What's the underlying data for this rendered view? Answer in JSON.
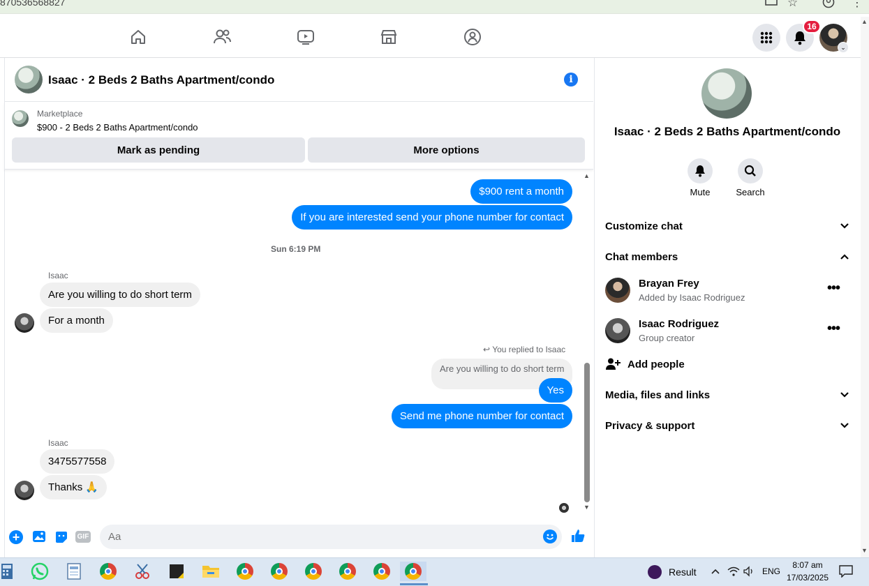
{
  "browser": {
    "url_fragment": "870536568827"
  },
  "nav": {
    "notification_count": "16"
  },
  "chat": {
    "title": "Isaac · 2 Beds 2 Baths Apartment/condo",
    "marketplace_label": "Marketplace",
    "listing": "$900 - 2 Beds 2 Baths Apartment/condo",
    "mark_pending_label": "Mark as pending",
    "more_options_label": "More options"
  },
  "messages": {
    "out1": "$900 rent a month",
    "out2": "If you are interested send your phone number for contact",
    "timestamp": "Sun 6:19 PM",
    "sender1": "Isaac",
    "in1": "Are you willing to do short term",
    "in2": "For a month",
    "replied_label": "You replied to Isaac",
    "quoted": "Are you willing to do short term",
    "out3": "Yes",
    "out4": "Send me phone number for contact",
    "sender2": "Isaac",
    "in3": "3475577558",
    "in4": "Thanks 🙏"
  },
  "composer": {
    "placeholder": "Aa"
  },
  "sidebar": {
    "title": "Isaac · 2 Beds 2 Baths Apartment/condo",
    "mute_label": "Mute",
    "search_label": "Search",
    "customize_label": "Customize chat",
    "members_label": "Chat members",
    "members": [
      {
        "name": "Brayan Frey",
        "sub": "Added by Isaac Rodriguez"
      },
      {
        "name": "Isaac Rodriguez",
        "sub": "Group creator"
      }
    ],
    "add_people_label": "Add people",
    "media_label": "Media, files and links",
    "privacy_label": "Privacy & support"
  },
  "taskbar": {
    "result_label": "Result",
    "lang": "ENG",
    "time": "8:07 am",
    "date": "17/03/2025"
  },
  "colors": {
    "messenger_blue": "#0084ff",
    "fb_blue": "#1877f2",
    "badge_red": "#e41e3f"
  }
}
